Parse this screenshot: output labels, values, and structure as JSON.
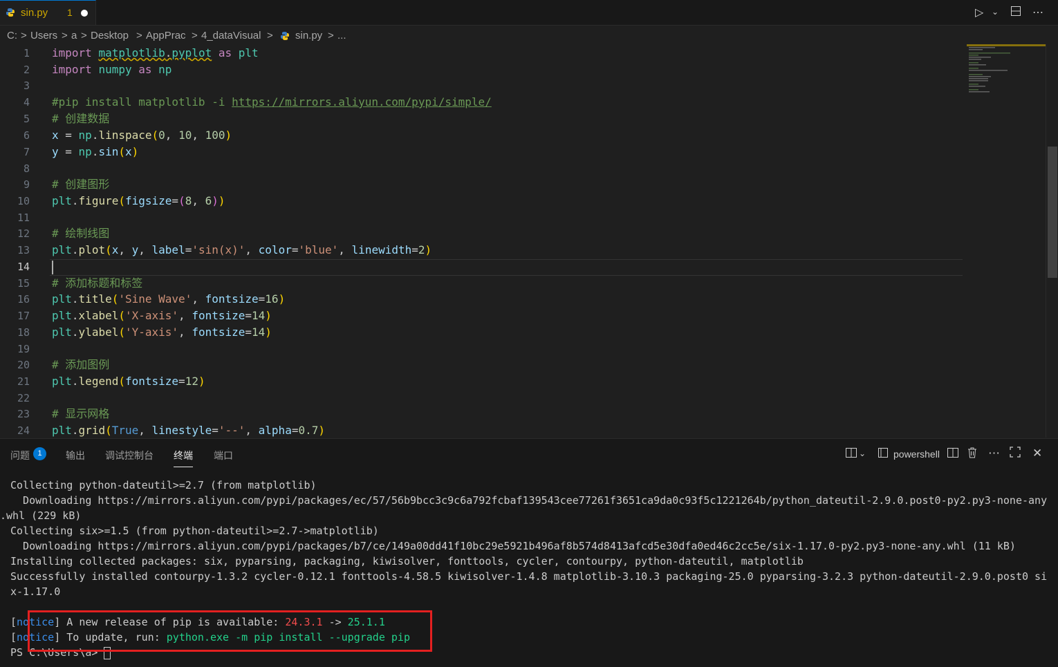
{
  "tab": {
    "filename": "sin.py",
    "problems": "1"
  },
  "breadcrumb": [
    "C:",
    ">",
    "Users",
    ">",
    "a",
    ">",
    "Desktop",
    ">",
    "AppPrac",
    ">",
    "4_dataVisual",
    ">",
    "sin.py",
    ">",
    "..."
  ],
  "editor": {
    "line_numbers": [
      "1",
      "2",
      "3",
      "4",
      "5",
      "6",
      "7",
      "8",
      "9",
      "10",
      "11",
      "12",
      "13",
      "14",
      "15",
      "16",
      "17",
      "18",
      "19",
      "20",
      "21",
      "22",
      "23",
      "24"
    ],
    "current_line": "14",
    "comments": {
      "l4": "#pip install matplotlib -i ",
      "l4_url": "https://mirrors.aliyun.com/pypi/simple/",
      "l5": "# 创建数据",
      "l9": "# 创建图形",
      "l12": "# 绘制线图",
      "l15": "# 添加标题和标签",
      "l20": "# 添加图例",
      "l23": "# 显示网格"
    }
  },
  "panel": {
    "tabs": [
      "问题",
      "输出",
      "调试控制台",
      "终端",
      "端口"
    ],
    "problems_count": "1",
    "shell": "powershell"
  },
  "terminal": {
    "lines": [
      "Collecting python-dateutil>=2.7 (from matplotlib)",
      "  Downloading https://mirrors.aliyun.com/pypi/packages/ec/57/56b9bcc3c9c6a792fcbaf139543cee77261f3651ca9da0c93f5c1221264b/python_dateutil-2.9.0.post0-py2.py3-none-any",
      ".whl (229 kB)",
      "Collecting six>=1.5 (from python-dateutil>=2.7->matplotlib)",
      "  Downloading https://mirrors.aliyun.com/pypi/packages/b7/ce/149a00dd41f10bc29e5921b496af8b574d8413afcd5e30dfa0ed46c2cc5e/six-1.17.0-py2.py3-none-any.whl (11 kB)",
      "Installing collected packages: six, pyparsing, packaging, kiwisolver, fonttools, cycler, contourpy, python-dateutil, matplotlib",
      "Successfully installed contourpy-1.3.2 cycler-0.12.1 fonttools-4.58.5 kiwisolver-1.4.8 matplotlib-3.10.3 packaging-25.0 pyparsing-3.2.3 python-dateutil-2.9.0.post0 si",
      "x-1.17.0"
    ],
    "notice_tag": "notice",
    "notice1_text": " A new release of pip is available: ",
    "notice1_old": "24.3.1",
    "notice1_arrow": " -> ",
    "notice1_new": "25.1.1",
    "notice2_text": " To update, run: ",
    "notice2_cmd": "python.exe -m pip install --upgrade pip",
    "prompt": "PS C:\\Users\\a> "
  },
  "colors": {
    "accent": "#0078d4",
    "highlight_box": "#e32020",
    "tab_text": "#cca700"
  }
}
